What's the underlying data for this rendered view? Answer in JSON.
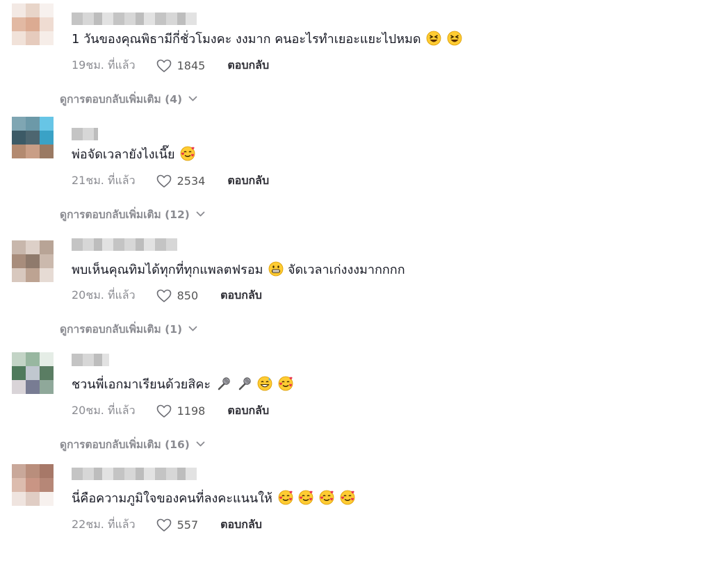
{
  "ui": {
    "reply_label": "ตอบกลับ",
    "view_more_prefix": "ดูการตอบกลับเพิ่มเติม"
  },
  "comments": [
    {
      "text": "1 วันของคุณพิธามีกี่ชั่วโมงคะ งงมาก คนอะไรทำเยอะแยะไปหมด",
      "emojis": [
        "laughing-face",
        "laughing-face"
      ],
      "time": "19ชม. ที่แล้ว",
      "likes": "1845",
      "more_replies": "(4)"
    },
    {
      "text": "พ่อจัดเวลายังไงเนี๊ย",
      "emojis": [
        "smiling-face-with-hearts"
      ],
      "time": "21ชม. ที่แล้ว",
      "likes": "2534",
      "more_replies": "(12)"
    },
    {
      "text": "พบเห็นคุณทิมได้ทุกที่ทุกแพลตฟรอม",
      "emojis": [
        "grinning-face"
      ],
      "text_after": "จัดเวลาเก่งงงมากกกก",
      "time": "20ชม. ที่แล้ว",
      "likes": "850",
      "more_replies": "(1)"
    },
    {
      "text": "ชวนพี่เอกมาเรียนด้วยสิคะ",
      "emojis": [
        "microphone",
        "microphone",
        "grinning-sweat-face",
        "smiling-face-with-hearts"
      ],
      "time": "20ชม. ที่แล้ว",
      "likes": "1198",
      "more_replies": "(16)"
    },
    {
      "text": "นี่คือความภูมิใจของคนที่ลงคะแนนให้",
      "emojis": [
        "smiling-face-with-hearts",
        "smiling-face-with-hearts",
        "smiling-face-with-hearts",
        "smiling-face-with-hearts"
      ],
      "time": "22ชม. ที่แล้ว",
      "likes": "557"
    }
  ]
}
